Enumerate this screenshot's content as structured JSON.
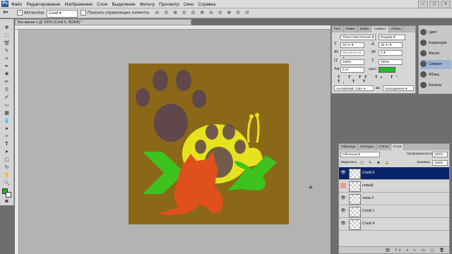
{
  "menubar": {
    "logo": "Ps",
    "items": [
      "Файл",
      "Редактирование",
      "Изображение",
      "Слои",
      "Выделение",
      "Фильтр",
      "Просмотр",
      "Окно",
      "Справка"
    ]
  },
  "options": {
    "autoselect_label": "Автовыбор:",
    "autoselect_value": "Слой",
    "show_controls_label": "Показать управляющие элементы"
  },
  "document": {
    "tab_title": "Без имени-1 @ 100% (Слой 5, RGB/8) *"
  },
  "char_panel": {
    "tabs": [
      "Гист",
      "Навиг",
      "Инфо",
      "Символ",
      "Абзац"
    ],
    "active_tab": "Символ",
    "font_family": "Times New Roman",
    "font_style": "Regular",
    "font_size": "32 пт",
    "leading": "30 пт",
    "kerning": "Метрически",
    "tracking": "0",
    "vscale": "100%",
    "hscale": "100%",
    "baseline": "0 пт",
    "color_label": "Цвет:",
    "text_color": "#22c022",
    "language": "Английский: США",
    "antialias": "Насыщенное"
  },
  "adjustments": {
    "items": [
      "Цвет",
      "Коррекция",
      "Маски",
      "Символ",
      "Абзац",
      "Каналы"
    ],
    "selected": "Символ"
  },
  "layers_panel": {
    "tabs": [
      "Образцы",
      "Контуры",
      "Стили",
      "Слои"
    ],
    "active_tab": "Слои",
    "blend_mode": "Обычные",
    "opacity_label": "Непрозрачность:",
    "opacity": "100%",
    "lock_label": "Закрепить:",
    "fill_label": "Заливка:",
    "fill": "100%",
    "layers": [
      {
        "name": "Слой 5",
        "active": true
      },
      {
        "name": "новый",
        "active": false
      },
      {
        "name": "лапа 2",
        "active": false
      },
      {
        "name": "Слой 1",
        "active": false
      },
      {
        "name": "Слой 4",
        "active": false
      }
    ]
  },
  "colors": {
    "canvas_bg": "#8a6818",
    "paw": "#5c4550",
    "snail": "#e6e21e",
    "green": "#3ec21e",
    "cat": "#e0501c",
    "foreground": "#1fb41f",
    "background": "#ffffff"
  }
}
